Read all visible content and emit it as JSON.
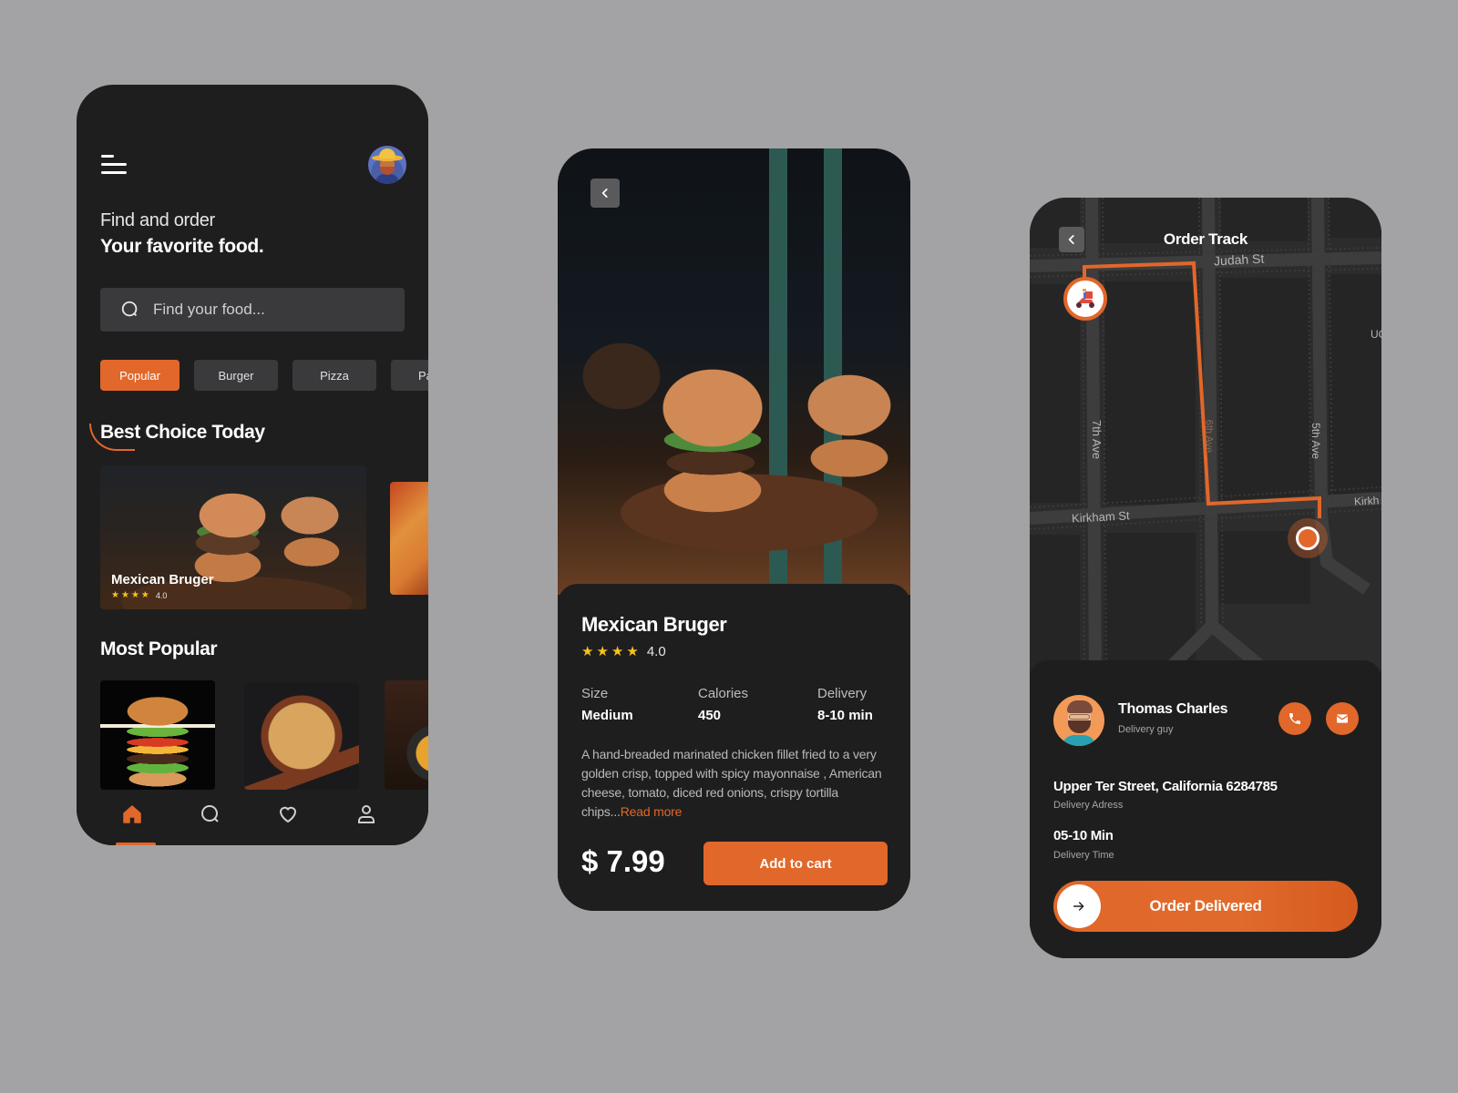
{
  "colors": {
    "accent": "#e1672a",
    "background": "#a3a3a5",
    "card": "#1e1e1e",
    "star": "#f8c21b"
  },
  "home": {
    "menu_icon": "hamburger-menu-icon",
    "avatar_icon": "user-avatar",
    "hero_line1": "Find and order",
    "hero_line2": "Your favorite food.",
    "search": {
      "icon": "search-icon",
      "placeholder": "Find your food...",
      "value": ""
    },
    "categories": [
      {
        "label": "Popular",
        "active": true
      },
      {
        "label": "Burger",
        "active": false
      },
      {
        "label": "Pizza",
        "active": false
      },
      {
        "label": "Pa",
        "active": false
      }
    ],
    "best_choice": {
      "title": "Best Choice Today",
      "featured": {
        "name": "Mexican Bruger",
        "stars": 4,
        "rating": "4.0"
      }
    },
    "most_popular": {
      "title": "Most Popular",
      "items": [
        "burger",
        "pizza",
        "pasta"
      ]
    },
    "bottom_nav": [
      {
        "name": "home",
        "icon": "home-icon",
        "active": true
      },
      {
        "name": "search",
        "icon": "search-icon",
        "active": false
      },
      {
        "name": "favorites",
        "icon": "heart-icon",
        "active": false
      },
      {
        "name": "profile",
        "icon": "user-icon",
        "active": false
      }
    ]
  },
  "detail": {
    "back_icon": "chevron-left-icon",
    "name": "Mexican Bruger",
    "stars": 4,
    "rating": "4.0",
    "specs": [
      {
        "label": "Size",
        "value": "Medium"
      },
      {
        "label": "Calories",
        "value": "450"
      },
      {
        "label": "Delivery",
        "value": "8-10 min"
      }
    ],
    "description": "A hand-breaded marinated chicken fillet fried to a very golden crisp, topped with spicy mayonnaise , American cheese, tomato, diced red onions, crispy tortilla chips...",
    "read_more": "Read more",
    "price": "$ 7.99",
    "add_to_cart": "Add to cart"
  },
  "track": {
    "title": "Order Track",
    "back_icon": "chevron-left-icon",
    "map_labels": {
      "judah": "Judah St",
      "kirkham": "Kirkham St",
      "seventh": "7th Ave",
      "sixth": "6th Ave",
      "fifth": "5th Ave",
      "edge_right_top": "UC",
      "edge_right_mid": "Kirkh"
    },
    "driver": {
      "name": "Thomas Charles",
      "role": "Delivery guy"
    },
    "address": {
      "value": "Upper Ter Street, California 6284785",
      "label": "Delivery Adress"
    },
    "time": {
      "value": "05-10 Min",
      "label": "Delivery Time"
    },
    "cta": "Order Delivered"
  }
}
